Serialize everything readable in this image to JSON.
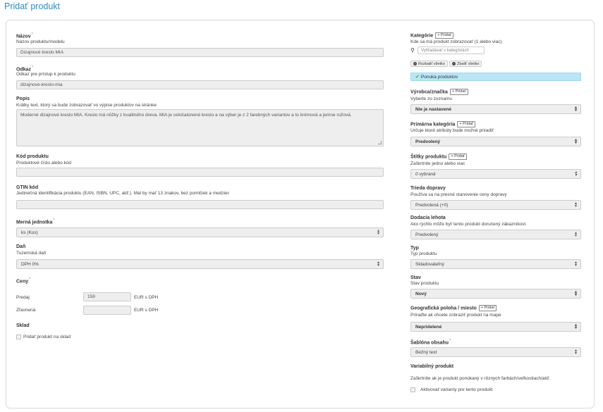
{
  "page_title": "Pridať produkt",
  "left": {
    "name": {
      "label": "Názov",
      "help": "Názov produktu/modelu",
      "value": "Dizajnové kreslo MIA"
    },
    "link": {
      "label": "Odkaz",
      "help": "Odkaz pre prístup k produktu",
      "value": "dizajnove-kreslo-mia"
    },
    "desc": {
      "label": "Popis",
      "help": "Krátky text, ktorý sa bude zobrazovať vo výpise produktov na stránke",
      "value": "Moderné dizajnové kreslo MIA. Kreslo má nôžky z kvalitného dreva. MIA je celočalúnené kreslo a na výber je z 2 farebných variantov a to krémová a jemne ružová."
    },
    "code": {
      "label": "Kód produktu",
      "help": "Produktové číslo alebo kód",
      "value": ""
    },
    "gtin": {
      "label": "GTIN kód",
      "help": "Jedinečná identifikácia produktu (EAN, ISBN, UPC, atď.). Mal by mať 13 znakov, bez pomlčiek a medzier",
      "value": ""
    },
    "unit": {
      "label": "Merná jednotka",
      "value": "ks (Kus)"
    },
    "tax": {
      "label": "Daň",
      "help": "Tuzemská daň",
      "value": "DPH 0%"
    },
    "prices": {
      "label": "Ceny",
      "sale_label": "Predaj",
      "sale_value": "159",
      "sale_unit": "EUR s DPH",
      "discount_label": "Zľavnená",
      "discount_value": "",
      "discount_unit": "EUR s DPH"
    },
    "stock": {
      "label": "Sklad",
      "checkbox_label": "Pridať produkt na sklad"
    }
  },
  "right": {
    "categories": {
      "label": "Kategórie",
      "add": "Pridať",
      "help": "Kde sa má produkt zobrazovať (1 alebo viac)",
      "search_placeholder": "Vyhľadávať v kategóriách",
      "expand": "Rozbaliť všetko",
      "collapse": "Zbaliť všetko",
      "selected": "Ponuka produktov"
    },
    "brand": {
      "label": "Výrobca/značka",
      "add": "Pridať",
      "help": "Vyberte zo zoznamu",
      "value": "Nie je nastavené"
    },
    "primary": {
      "label": "Primárna kategória",
      "add": "Pridať",
      "help": "Určuje ktoré atribúty bude možné priradiť",
      "value": "Predvolený"
    },
    "tags": {
      "label": "Štítky produktu",
      "add": "Pridať",
      "help": "Zaškrtnite jedno alebo viac",
      "value": "0 vybraná"
    },
    "shipping": {
      "label": "Trieda dopravy",
      "help": "Používa sa na presné stanovenie ceny dopravy",
      "value": "Predvolená (+0)"
    },
    "delivery": {
      "label": "Dodacia lehota",
      "help": "Ako rýchlo môže byť tento produkt doručený zákazníkovi.",
      "value": "Predvolený"
    },
    "type": {
      "label": "Typ",
      "help": "Typ produktu",
      "value": "Skladovateľný"
    },
    "state": {
      "label": "Stav",
      "help": "Stav produktu",
      "value": "Nový"
    },
    "geo": {
      "label": "Geografická poloha / miesto",
      "add": "Pridať",
      "help": "Priraďte ak chcete zobraziť produkt na mape",
      "value": "Nepridelené"
    },
    "template": {
      "label": "Šablóna obsahu",
      "value": "Bežný text"
    },
    "variant": {
      "label": "Variabilný produkt",
      "help": "Zaškrtnite ak je produkt ponúkaný v rôznych farbách/veľkostiach/atď.",
      "checkbox_label": "Aktivovať varianty pre tento produkt"
    }
  }
}
